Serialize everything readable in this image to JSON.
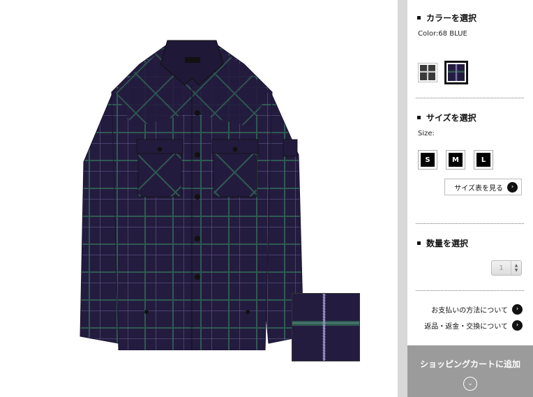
{
  "colors": {
    "shirt_base": "#241c3f",
    "plaid_green": "#2f5a52",
    "plaid_light": "#5f5a88",
    "panel_divider": "#d8d8d8",
    "cart_button": "#9b9b9b"
  },
  "color_section": {
    "title": "カラーを選択",
    "selected": "Color:68 BLUE",
    "options": [
      {
        "id": "gray-plaid",
        "color": "#3a3a3a",
        "selected": false
      },
      {
        "id": "68-blue",
        "color": "#241c3f",
        "selected": true
      }
    ]
  },
  "size_section": {
    "title": "サイズを選択",
    "label": "Size:",
    "sizes": [
      "S",
      "M",
      "L"
    ],
    "size_chart_label": "サイズ表を見る"
  },
  "quantity_section": {
    "title": "数量を選択",
    "value": "1"
  },
  "links": {
    "payment": "お支払いの方法について",
    "returns": "返品・返金・交換について"
  },
  "cart": {
    "label": "ショッピングカートに追加"
  },
  "icons": {
    "arrow": "circle-arrow-right-icon",
    "down": "chevron-down-circle-icon"
  }
}
